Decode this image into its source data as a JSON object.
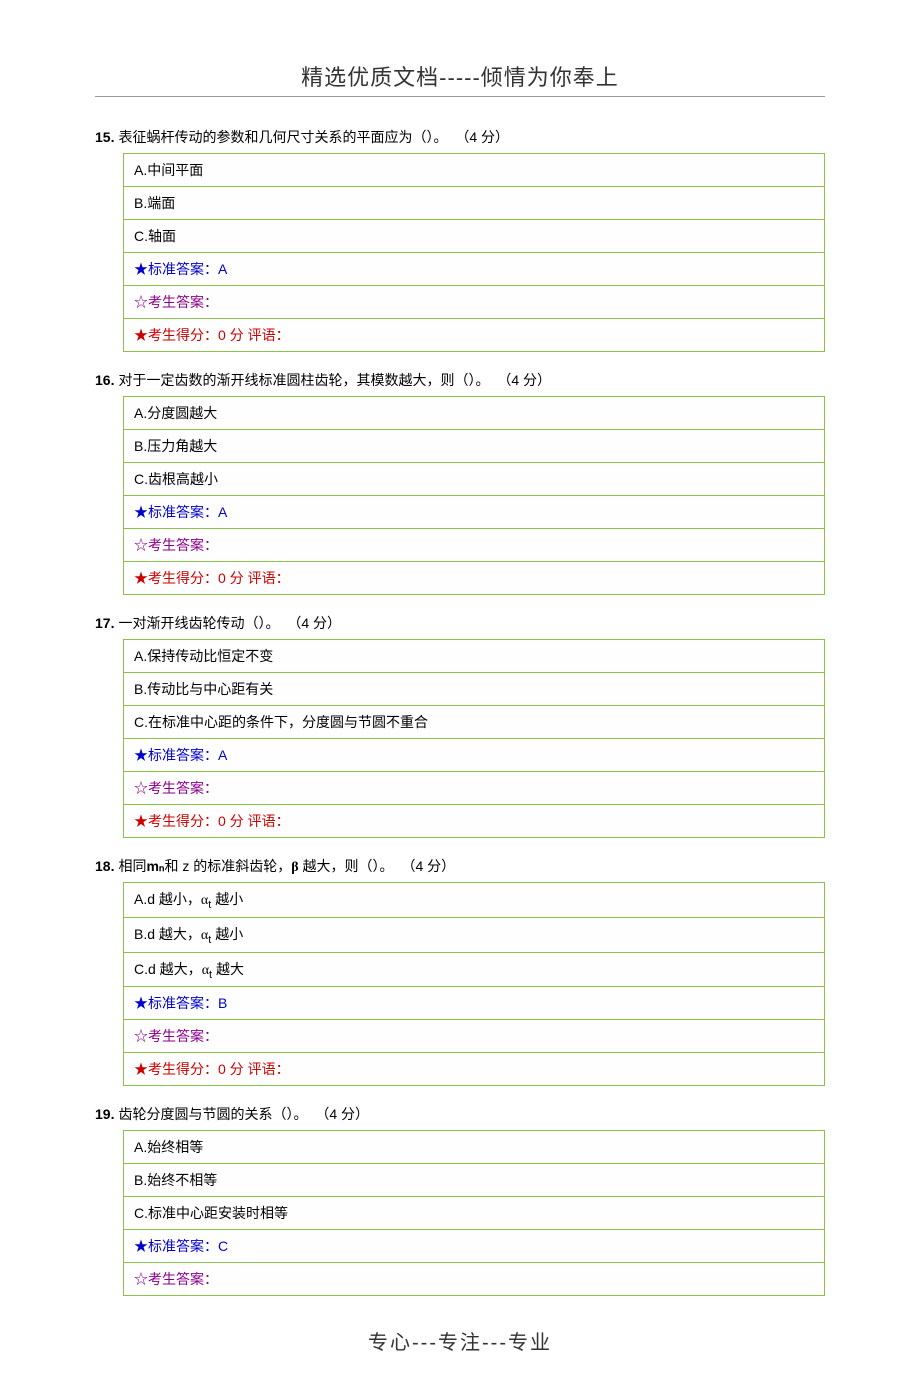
{
  "header": "精选优质文档-----倾情为你奉上",
  "footer": "专心---专注---专业",
  "common": {
    "stdAnswerPrefix": "★标准答案：",
    "candAnswerPrefix": "☆考生答案：",
    "candScorePrefix": "★考生得分：",
    "scoreValue": "0 分",
    "commentLabel": "  评语："
  },
  "questions": [
    {
      "number": "15.",
      "text": "表征蜗杆传动的参数和几何尺寸关系的平面应为（）。",
      "points": "（4 分）",
      "options": [
        "A.中间平面",
        "B.端面",
        "C.轴面"
      ],
      "stdAnswer": "A",
      "candAnswer": "",
      "showScore": true
    },
    {
      "number": "16.",
      "text": "对于一定齿数的渐开线标准圆柱齿轮，其模数越大，则（）。",
      "points": "（4 分）",
      "options": [
        "A.分度圆越大",
        "B.压力角越大",
        "C.齿根高越小"
      ],
      "stdAnswer": "A",
      "candAnswer": "",
      "showScore": true
    },
    {
      "number": "17.",
      "text": "一对渐开线齿轮传动（）。",
      "points": "（4 分）",
      "options": [
        "A.保持传动比恒定不变",
        "B.传动比与中心距有关",
        "C.在标准中心距的条件下，分度圆与节圆不重合"
      ],
      "stdAnswer": "A",
      "candAnswer": "",
      "showScore": true
    },
    {
      "number": "18.",
      "text_pre": "相同",
      "text_sym1": "mₙ",
      "text_mid1": "和 z 的标准斜齿轮，",
      "text_sym2": "β",
      "text_mid2": " 越大，则（）。",
      "points": "（4 分）",
      "options_special": [
        {
          "pre": "A.d 越小，",
          "sym": "α",
          "sub": "t",
          "post": " 越小"
        },
        {
          "pre": "B.d 越大，",
          "sym": "α",
          "sub": "t",
          "post": " 越小"
        },
        {
          "pre": "C.d 越大，",
          "sym": "α",
          "sub": "t",
          "post": " 越大"
        }
      ],
      "stdAnswer": "B",
      "candAnswer": "",
      "showScore": true
    },
    {
      "number": "19.",
      "text": "齿轮分度圆与节圆的关系（）。",
      "points": "（4 分）",
      "options": [
        "A.始终相等",
        "B.始终不相等",
        "C.标准中心距安装时相等"
      ],
      "stdAnswer": "C",
      "candAnswer": "",
      "showScore": false
    }
  ]
}
